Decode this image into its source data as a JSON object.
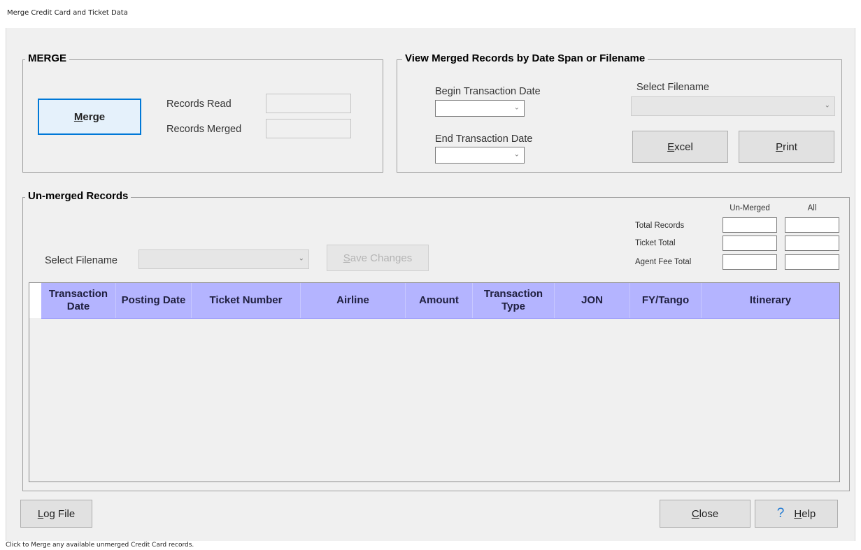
{
  "window": {
    "title": "Merge Credit Card and Ticket Data"
  },
  "merge_group": {
    "legend": "MERGE",
    "merge_button": {
      "prefix": "",
      "accel": "M",
      "suffix": "erge"
    },
    "records_read_label": "Records Read",
    "records_read_value": "",
    "records_merged_label": "Records Merged",
    "records_merged_value": ""
  },
  "view_group": {
    "legend": "View Merged Records by Date Span or Filename",
    "begin_label": "Begin Transaction Date",
    "end_label": "End Transaction Date",
    "select_filename_label": "Select Filename",
    "excel_button": {
      "prefix": "",
      "accel": "E",
      "suffix": "xcel"
    },
    "print_button": {
      "prefix": "",
      "accel": "P",
      "suffix": "rint"
    }
  },
  "unmerged_group": {
    "legend": "Un-merged Records",
    "select_filename_label": "Select Filename",
    "save_changes_button": {
      "prefix": "",
      "accel": "S",
      "suffix": "ave Changes"
    },
    "totals": {
      "col_unmerged": "Un-Merged",
      "col_all": "All",
      "rows": [
        "Total Records",
        "Ticket Total",
        "Agent Fee Total"
      ]
    },
    "columns": [
      "Transaction Date",
      "Posting Date",
      "Ticket Number",
      "Airline",
      "Amount",
      "Transaction Type",
      "JON",
      "FY/Tango",
      "Itinerary"
    ]
  },
  "footer": {
    "log_file_button": {
      "prefix": "",
      "accel": "L",
      "suffix": "og File"
    },
    "close_button": {
      "prefix": "",
      "accel": "C",
      "suffix": "lose"
    },
    "help_button": {
      "icon": "?",
      "prefix": "",
      "accel": "H",
      "suffix": "elp"
    }
  },
  "status_bar": {
    "text": "Click to Merge any available unmerged Credit Card records."
  },
  "colors": {
    "grid_header": "#b4b4ff",
    "focus_border": "#0078d7",
    "help_icon": "#1e78d2"
  }
}
